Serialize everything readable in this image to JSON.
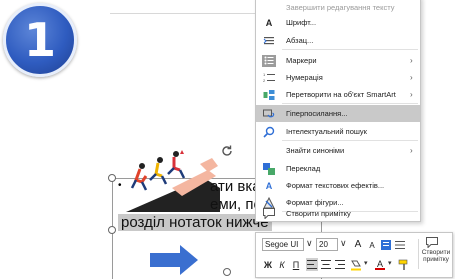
{
  "step_badge": "1",
  "slide": {
    "bullet": "•",
    "line1": "ати вка",
    "line2": "еми, пе",
    "line3": "розділ нотаток нижче",
    "arrow_color": "#3a6fd0"
  },
  "context_menu": {
    "items": [
      {
        "label": "Завершити редагування тексту",
        "icon": "edit-exit-icon"
      },
      {
        "label": "Шрифт...",
        "icon": "font-icon"
      },
      {
        "label": "Абзац...",
        "icon": "paragraph-icon"
      },
      {
        "label": "Маркери",
        "icon": "bullets-icon",
        "submenu": true
      },
      {
        "label": "Нумерація",
        "icon": "numbering-icon",
        "submenu": true
      },
      {
        "label": "Перетворити на об'єкт SmartArt",
        "icon": "smartart-icon",
        "submenu": true
      },
      {
        "label": "Гіперпосилання...",
        "icon": "hyperlink-icon"
      },
      {
        "label": "Інтелектуальний пошук",
        "icon": "smart-lookup-icon"
      },
      {
        "label": "Знайти синоніми",
        "icon": "",
        "submenu": true
      },
      {
        "label": "Переклад",
        "icon": "translate-icon"
      },
      {
        "label": "Формат текстових ефектів...",
        "icon": "text-effects-icon"
      },
      {
        "label": "Формат фігури...",
        "icon": "format-shape-icon"
      },
      {
        "label": "Створити примітку",
        "icon": "comment-icon"
      }
    ]
  },
  "mini_toolbar": {
    "font": "Segoe UI",
    "size": "20",
    "grow": "A",
    "shrink": "A",
    "bold": "Ж",
    "italic": "К",
    "underline": "П",
    "font_color_label": "A",
    "new_comment": "Створити примітку",
    "font_color": "#d40000",
    "highlight_color": "#ffd400"
  },
  "colors": {
    "badge": "#2f5cc0",
    "menu_hover": "#c9c9c9"
  }
}
